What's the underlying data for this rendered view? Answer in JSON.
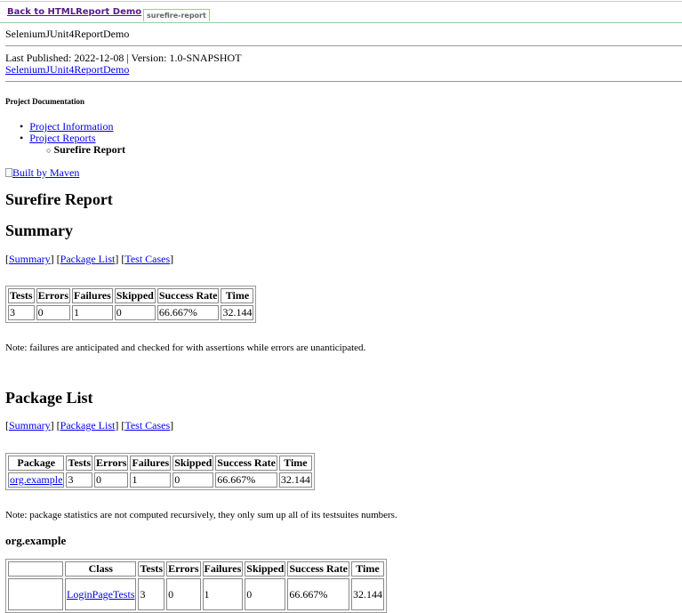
{
  "header": {
    "back_link": "Back to HTMLReport  Demo",
    "tab": "surefire-report",
    "project_name": "SeleniumJUnit4ReportDemo",
    "published": "Last Published: 2022-12-08 | Version: 1.0-SNAPSHOT",
    "project_link": "SeleniumJUnit4ReportDemo"
  },
  "nav": {
    "heading": "Project Documentation",
    "items": [
      "Project Information",
      "Project Reports"
    ],
    "subitem": "Surefire Report",
    "maven_badge": "Built by Maven"
  },
  "report": {
    "title": "Surefire Report",
    "summary": {
      "title": "Summary",
      "links": [
        "Summary",
        "Package List",
        "Test Cases"
      ],
      "headers": [
        "Tests",
        "Errors",
        "Failures",
        "Skipped",
        "Success Rate",
        "Time"
      ],
      "row": [
        "3",
        "0",
        "1",
        "0",
        "66.667%",
        "32.144"
      ],
      "note": "Note: failures are anticipated and checked for with assertions while errors are unanticipated."
    },
    "packages": {
      "title": "Package List",
      "links": [
        "Summary",
        "Package List",
        "Test Cases"
      ],
      "headers": [
        "Package",
        "Tests",
        "Errors",
        "Failures",
        "Skipped",
        "Success Rate",
        "Time"
      ],
      "row": [
        "org.example",
        "3",
        "0",
        "1",
        "0",
        "66.667%",
        "32.144"
      ],
      "note": "Note: package statistics are not computed recursively, they only sum up all of its testsuites numbers."
    },
    "pkg": {
      "title": "org.example",
      "headers": [
        "",
        "Class",
        "Tests",
        "Errors",
        "Failures",
        "Skipped",
        "Success Rate",
        "Time"
      ],
      "row": [
        "",
        "LoginPageTests",
        "3",
        "0",
        "1",
        "0",
        "66.667%",
        "32.144"
      ]
    }
  }
}
